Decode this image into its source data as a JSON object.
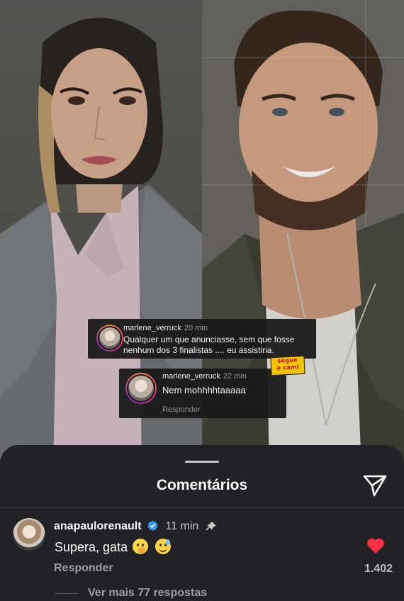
{
  "overlay_comments": [
    {
      "username": "marlene_verruck",
      "time": "20 min",
      "text_line1": "Qualquer um que anunciasse, sem que fosse",
      "text_line2": "nenhum dos 3 finalistas .... eu assistiria."
    },
    {
      "username": "marlene_verruck",
      "time": "22 min",
      "text": "Nem mohhhhtaaaaa",
      "reply_label": "Responder"
    }
  ],
  "sticker": {
    "line1": "segue",
    "line2": "a cami"
  },
  "sheet": {
    "title": "Comentários",
    "share_icon": "send-icon"
  },
  "comment": {
    "username": "anapaulorenault",
    "verified": true,
    "time": "11 min",
    "pinned": true,
    "text": "Supera, gata",
    "emojis": [
      "shushing-face",
      "grinning-sweat-face"
    ],
    "reply_label": "Responder",
    "likes": "1.402",
    "liked": true,
    "view_more": "Ver mais 77 respostas"
  },
  "colors": {
    "sheet_bg": "#202226",
    "like_red": "#ff3040",
    "verified_blue": "#3897f0",
    "sticker_yellow": "#f5c400"
  }
}
